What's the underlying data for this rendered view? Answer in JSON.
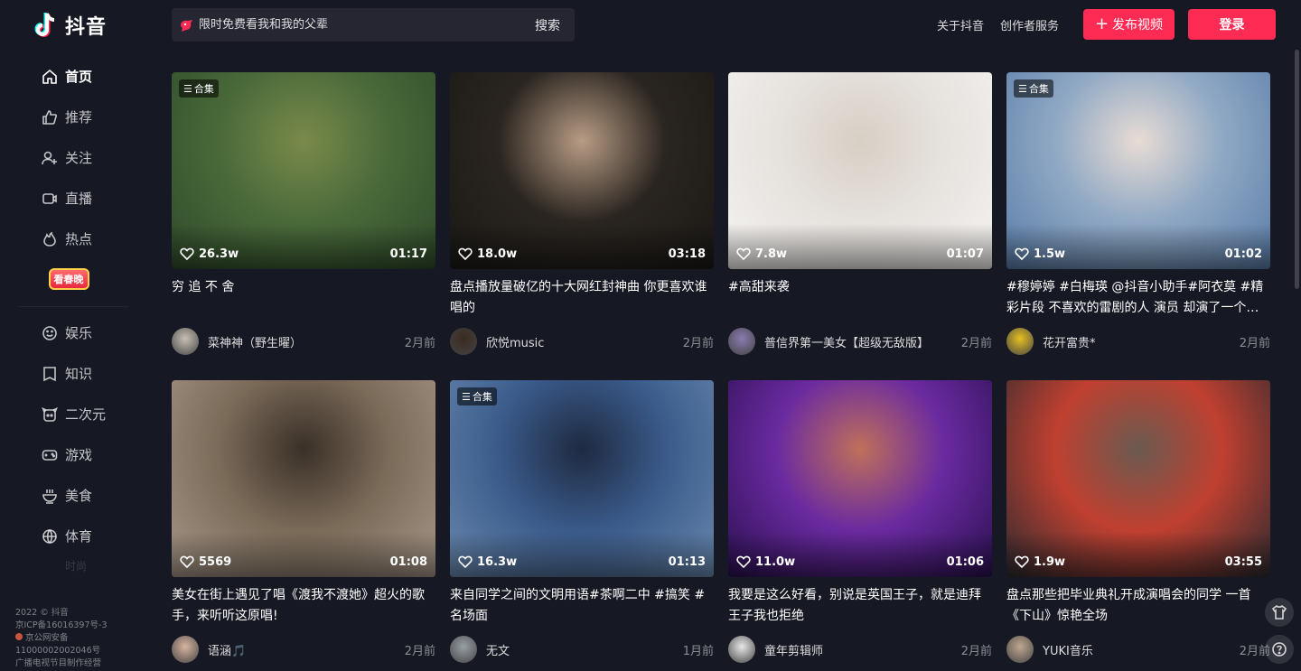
{
  "logo": {
    "text": "抖音"
  },
  "search": {
    "placeholder": "限时免费看我和我的父辈",
    "button": "搜索"
  },
  "header": {
    "links": [
      "关于抖音",
      "创作者服务"
    ],
    "upload": "发布视频",
    "login": "登录"
  },
  "sidebar": {
    "items": [
      {
        "label": "首页",
        "icon": "home-icon"
      },
      {
        "label": "推荐",
        "icon": "thumb-up-icon"
      },
      {
        "label": "关注",
        "icon": "user-follow-icon"
      },
      {
        "label": "直播",
        "icon": "live-icon"
      },
      {
        "label": "热点",
        "icon": "flame-icon"
      }
    ],
    "promo": "看春晚",
    "items2": [
      {
        "label": "娱乐",
        "icon": "smile-icon"
      },
      {
        "label": "知识",
        "icon": "book-icon"
      },
      {
        "label": "二次元",
        "icon": "anime-icon"
      },
      {
        "label": "游戏",
        "icon": "gamepad-icon"
      },
      {
        "label": "美食",
        "icon": "bowl-icon"
      },
      {
        "label": "体育",
        "icon": "ball-icon"
      }
    ],
    "faded_label": "时尚",
    "footer": [
      "2022 © 抖音",
      "京ICP备16016397号-3",
      "京公网安备",
      "11000002002046号",
      "广播电视节目制作经营"
    ]
  },
  "collection_label": "合集",
  "videos": [
    {
      "title": "穷 追 不 舍",
      "likes": "26.3w",
      "duration": "01:17",
      "author": "菜神神（野生曜）",
      "time": "2月前",
      "collection": true,
      "colors": [
        "#4a6a3a",
        "#7a8a4a",
        "#2e4a2a"
      ],
      "avatar": "#c9c0b4"
    },
    {
      "title": "盘点播放量破亿的十大网红封神曲 你更喜欢谁唱的",
      "likes": "18.0w",
      "duration": "03:18",
      "author": "欣悦music",
      "time": "2月前",
      "collection": false,
      "colors": [
        "#2a2520",
        "#b89c84",
        "#1a1815"
      ],
      "avatar": "#3a2a20"
    },
    {
      "title": "#高甜来袭",
      "likes": "7.8w",
      "duration": "01:07",
      "author": "普信界第一美女【超级无敌版】",
      "time": "2月前",
      "collection": false,
      "colors": [
        "#e6e2de",
        "#d8cfc4",
        "#f4f2f0"
      ],
      "avatar": "#8a7ab0"
    },
    {
      "title": "#穆婷婷 #白梅瑛 @抖音小助手#阿衣莫 #精彩片段 不喜欢的雷剧的人 演员 却演了一个…",
      "likes": "1.5w",
      "duration": "01:02",
      "author": "花开富贵*",
      "time": "2月前",
      "collection": true,
      "colors": [
        "#8fa8c4",
        "#e8dcd4",
        "#5a7ca8"
      ],
      "avatar": "#e8c020"
    },
    {
      "title": "美女在街上遇见了唱《渡我不渡她》超火的歌手，来听听这原唱!",
      "likes": "5569",
      "duration": "01:08",
      "author": "语涵🎵",
      "time": "2月前",
      "collection": false,
      "colors": [
        "#7a6a58",
        "#3a3028",
        "#a8988a"
      ],
      "avatar": "#d8b4a0"
    },
    {
      "title": "来自同学之间的文明用语#茶啊二中 #搞笑 #名场面",
      "likes": "16.3w",
      "duration": "01:13",
      "author": "无文",
      "time": "1月前",
      "collection": true,
      "colors": [
        "#3a5a8a",
        "#1e2a40",
        "#6a8ab0"
      ],
      "avatar": "#9aa0a8"
    },
    {
      "title": "我要是这么好看，别说是英国王子，就是迪拜王子我也拒绝",
      "likes": "11.0w",
      "duration": "01:06",
      "author": "童年剪辑师",
      "time": "2月前",
      "collection": false,
      "colors": [
        "#6a2aa0",
        "#c0705a",
        "#2a1050"
      ],
      "avatar": "#e8e8e8"
    },
    {
      "title": "盘点那些把毕业典礼开成演唱会的同学 一首《下山》惊艳全场",
      "likes": "1.9w",
      "duration": "03:55",
      "author": "YUKI音乐",
      "time": "2月前",
      "collection": false,
      "colors": [
        "#c04030",
        "#6a5a50",
        "#2a2a30"
      ],
      "avatar": "#c0a890"
    }
  ]
}
